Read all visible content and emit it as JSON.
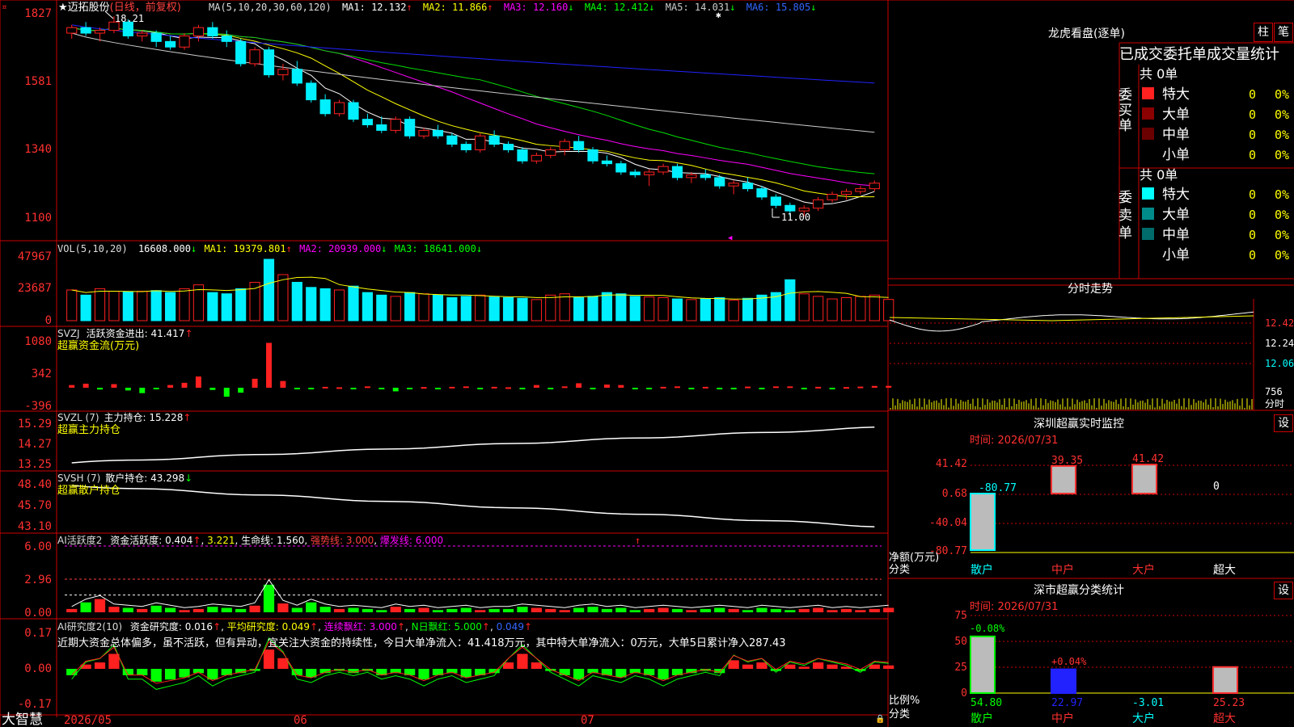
{
  "colors": {
    "up": "#ff2020",
    "down": "#00f0ff",
    "ma1": "#ffffff",
    "ma2": "#ffff00",
    "ma3": "#ff00ff",
    "ma4": "#00dd00",
    "ma5": "#cccccc",
    "ma6": "#2222ff",
    "frame": "#cc0000",
    "label_red": "#ff4040",
    "label_yellow": "#ffff00",
    "label_green": "#00ff00",
    "label_magenta": "#ff00ff",
    "label_cyan": "#00ffff",
    "label_blue": "#3366ff"
  },
  "header": {
    "title_prefix": "★",
    "stock_name": "迈拓股份",
    "period": "(日线，前复权)",
    "ma_params": "MA(5,10,20,30,60,120)",
    "ma1_text": "MA1: 12.132",
    "ma1_arrow": "↑",
    "ma2_text": "MA2: 11.866",
    "ma2_arrow": "↑",
    "ma3_text": "MA3: 12.160",
    "ma3_arrow": "↓",
    "ma4_text": "MA4: 12.412",
    "ma4_arrow": "↓",
    "ma5_text": "MA5: 14.031",
    "ma5_arrow": "↓",
    "ma6_text": "MA6: 15.805",
    "ma6_arrow": "↓",
    "high_label": "18.21",
    "low_label": "11.00"
  },
  "vol_pane": {
    "label": "VOL(5,10,20)",
    "vol_text": "16608.000",
    "vol_arrow": "↓",
    "ma1_text": "MA1: 19379.801",
    "ma1_arrow": "↑",
    "ma2_text": "MA2: 20939.000",
    "ma2_arrow": "↓",
    "ma3_text": "MA3: 18641.000",
    "ma3_arrow": "↓"
  },
  "svzj_pane": {
    "label": "SVZJ",
    "title": "活跃资金进出: 41.417",
    "arrow": "↑",
    "sub": "超赢资金流(万元)"
  },
  "svzl_pane": {
    "label": "SVZL (7)",
    "title": "主力持仓: 15.228",
    "arrow": "↑",
    "sub": "超赢主力持仓"
  },
  "svsh_pane": {
    "label": "SVSH (7)",
    "title": "散户持仓: 43.298",
    "arrow": "↓",
    "sub": "超赢散户持仓"
  },
  "ai1_pane": {
    "label": "AI活跃度2",
    "t1": "资金活跃度: 0.404",
    "a1": "↑",
    "t2": "3.221",
    "t3": "生命线: 1.560",
    "t4": "强势线: 3.000",
    "t5": "爆发线: 6.000"
  },
  "ai2_pane": {
    "label": "AI研究度2(10)",
    "t1": "资金研究度: 0.016",
    "a1": "↑",
    "t2": "平均研究度: 0.049",
    "a2": "↑",
    "t3": "连续飘红: 3.000",
    "a3": "↑",
    "t4": "N日飘红: 5.000",
    "a4": "↑",
    "t5": "0.049",
    "a5": "↑",
    "comment": "近期大资金总体偏多，虽不活跃，但有异动，宜关注大资金的持续性，今日大单净流入：41.418万元，其中特大单净流入：0万元，大单5日累计净入287.43"
  },
  "axis": {
    "price_ticks": [
      "1827",
      "1581",
      "1340",
      "1100"
    ],
    "vol_ticks": [
      "47967",
      "23687",
      "0"
    ],
    "svzj_ticks": [
      "1080",
      "342",
      "-396"
    ],
    "svzl_ticks": [
      "15.29",
      "14.27",
      "13.25"
    ],
    "svsh_ticks": [
      "48.40",
      "45.70",
      "43.10"
    ],
    "ai1_ticks": [
      "6.00",
      "2.96",
      "0.00"
    ],
    "ai2_ticks": [
      "0.17",
      "0.00",
      "-0.17"
    ],
    "date_labels": [
      "2026/05",
      "06",
      "07"
    ],
    "brand": "大智慧"
  },
  "right": {
    "lhb_title": "龙虎看盘(逐单)",
    "btn_zhu": "柱",
    "btn_bi": "笔",
    "lhb_header": "已成交委托单成交量统计",
    "buy_group": "委买单",
    "sell_group": "委卖单",
    "buy_total": "共 0单",
    "sell_total": "共 0单",
    "buy_rows": [
      {
        "name": "特大",
        "count": "0",
        "pct": "0%"
      },
      {
        "name": "大单",
        "count": "0",
        "pct": "0%"
      },
      {
        "name": "中单",
        "count": "0",
        "pct": "0%"
      },
      {
        "name": "小单",
        "count": "0",
        "pct": "0%"
      }
    ],
    "sell_rows": [
      {
        "name": "特大",
        "count": "0",
        "pct": "0%"
      },
      {
        "name": "大单",
        "count": "0",
        "pct": "0%"
      },
      {
        "name": "中单",
        "count": "0",
        "pct": "0%"
      },
      {
        "name": "小单",
        "count": "0",
        "pct": "0%"
      }
    ],
    "intraday_title": "分时走势",
    "intraday_ticks": [
      "12.42",
      "12.24",
      "12.06"
    ],
    "intraday_vol": "756",
    "intraday_unit": "分时",
    "monitor_title": "深圳超赢实时监控",
    "monitor_btn": "设",
    "monitor_time": "时间: 2026/07/31",
    "monitor_ticks": [
      "41.42",
      "0.68",
      "-40.04",
      "-80.77"
    ],
    "monitor_ylabel": "净额(万元)",
    "monitor_xlabel": "分类",
    "classify_title": "深市超赢分类统计",
    "classify_btn": "设",
    "classify_time": "时间: 2026/07/31",
    "classify_ticks": [
      "75",
      "50",
      "25",
      "0"
    ],
    "classify_ylabel": "比例%",
    "classify_xlabel": "分类",
    "classify_pcts": [
      "-0.08%",
      "+0.04%"
    ]
  },
  "chart_data": [
    {
      "type": "candlestick",
      "title": "迈拓股份 (日线，前复权)",
      "ylim": [
        11.0,
        18.27
      ],
      "y_ticks": [
        18.27,
        15.81,
        13.4,
        11.0
      ],
      "x_labels": [
        "2026/05",
        "06",
        "07"
      ],
      "high": 18.21,
      "low": 11.0,
      "ohlc": [
        [
          17.6,
          17.9,
          17.4,
          17.8
        ],
        [
          17.8,
          18.0,
          17.5,
          17.6
        ],
        [
          17.6,
          17.8,
          17.3,
          17.7
        ],
        [
          17.7,
          18.21,
          17.6,
          18.0
        ],
        [
          18.0,
          18.1,
          17.4,
          17.5
        ],
        [
          17.5,
          17.7,
          17.3,
          17.6
        ],
        [
          17.6,
          17.7,
          17.1,
          17.3
        ],
        [
          17.3,
          17.5,
          17.0,
          17.1
        ],
        [
          17.1,
          17.6,
          17.0,
          17.5
        ],
        [
          17.5,
          17.9,
          17.3,
          17.8
        ],
        [
          17.8,
          18.0,
          17.4,
          17.5
        ],
        [
          17.5,
          17.7,
          17.1,
          17.3
        ],
        [
          17.3,
          17.4,
          16.4,
          16.5
        ],
        [
          16.5,
          17.1,
          16.4,
          17.0
        ],
        [
          17.0,
          17.1,
          16.0,
          16.1
        ],
        [
          16.1,
          16.5,
          15.9,
          16.3
        ],
        [
          16.3,
          16.6,
          15.7,
          15.8
        ],
        [
          15.8,
          15.9,
          15.1,
          15.2
        ],
        [
          15.2,
          15.4,
          14.6,
          14.7
        ],
        [
          14.7,
          15.2,
          14.6,
          15.1
        ],
        [
          15.1,
          15.2,
          14.4,
          14.5
        ],
        [
          14.5,
          14.7,
          14.2,
          14.3
        ],
        [
          14.3,
          14.6,
          14.0,
          14.1
        ],
        [
          14.1,
          14.6,
          14.0,
          14.5
        ],
        [
          14.5,
          14.6,
          13.8,
          13.9
        ],
        [
          13.9,
          14.2,
          13.8,
          14.1
        ],
        [
          14.1,
          14.3,
          13.8,
          13.9
        ],
        [
          13.9,
          14.0,
          13.5,
          13.6
        ],
        [
          13.6,
          13.7,
          13.3,
          13.4
        ],
        [
          13.4,
          14.0,
          13.3,
          13.9
        ],
        [
          13.9,
          14.1,
          13.5,
          13.6
        ],
        [
          13.6,
          13.7,
          13.3,
          13.4
        ],
        [
          13.4,
          13.5,
          12.9,
          13.0
        ],
        [
          13.0,
          13.3,
          12.9,
          13.2
        ],
        [
          13.2,
          13.5,
          13.1,
          13.4
        ],
        [
          13.4,
          13.8,
          13.2,
          13.7
        ],
        [
          13.7,
          13.9,
          13.3,
          13.4
        ],
        [
          13.4,
          13.5,
          12.9,
          13.0
        ],
        [
          13.0,
          13.2,
          12.8,
          12.9
        ],
        [
          12.9,
          13.0,
          12.5,
          12.6
        ],
        [
          12.6,
          12.7,
          12.4,
          12.5
        ],
        [
          12.5,
          12.7,
          12.1,
          12.6
        ],
        [
          12.6,
          12.9,
          12.5,
          12.8
        ],
        [
          12.8,
          12.9,
          12.3,
          12.4
        ],
        [
          12.4,
          12.6,
          12.2,
          12.5
        ],
        [
          12.5,
          12.7,
          12.3,
          12.4
        ],
        [
          12.4,
          12.5,
          12.0,
          12.1
        ],
        [
          12.1,
          12.3,
          11.8,
          12.2
        ],
        [
          12.2,
          12.4,
          11.9,
          12.0
        ],
        [
          12.0,
          12.1,
          11.6,
          11.7
        ],
        [
          11.7,
          11.8,
          11.3,
          11.4
        ],
        [
          11.4,
          11.5,
          11.0,
          11.2
        ],
        [
          11.2,
          11.4,
          11.0,
          11.3
        ],
        [
          11.3,
          11.7,
          11.2,
          11.6
        ],
        [
          11.6,
          11.9,
          11.5,
          11.8
        ],
        [
          11.8,
          12.0,
          11.6,
          11.9
        ],
        [
          11.9,
          12.1,
          11.8,
          12.0
        ],
        [
          12.0,
          12.3,
          11.9,
          12.2
        ]
      ],
      "series": [
        {
          "name": "MA1",
          "value": 12.132
        },
        {
          "name": "MA2",
          "value": 11.866
        },
        {
          "name": "MA3",
          "value": 12.16
        },
        {
          "name": "MA4",
          "value": 12.412
        },
        {
          "name": "MA5",
          "value": 14.031
        },
        {
          "name": "MA6",
          "value": 15.805
        }
      ]
    },
    {
      "type": "bar",
      "title": "VOL(5,10,20)",
      "ylim": [
        0,
        47967
      ],
      "y_ticks": [
        47967,
        23687,
        0
      ],
      "values": [
        24000,
        20000,
        25000,
        23000,
        22500,
        23000,
        23500,
        22000,
        25000,
        28000,
        22000,
        21000,
        25000,
        30000,
        47967,
        36000,
        30000,
        26000,
        25000,
        24000,
        27000,
        22000,
        20000,
        19000,
        22000,
        21000,
        20000,
        18000,
        19000,
        20000,
        18500,
        18000,
        17500,
        16500,
        20000,
        21000,
        18000,
        19000,
        22000,
        21000,
        19000,
        18500,
        18000,
        17000,
        16500,
        17000,
        18000,
        16000,
        17500,
        20000,
        22000,
        32000,
        21000,
        19000,
        17000,
        18000,
        19000,
        20000,
        16608
      ],
      "series": [
        {
          "name": "MA1",
          "value": 19379.801
        },
        {
          "name": "MA2",
          "value": 20939.0
        },
        {
          "name": "MA3",
          "value": 18641.0
        }
      ]
    },
    {
      "type": "bar",
      "title": "超赢资金流(万元)",
      "ylim": [
        -396,
        1080
      ],
      "y_ticks": [
        1080,
        342,
        -396
      ],
      "values": [
        60,
        90,
        -40,
        80,
        -60,
        -120,
        -30,
        60,
        110,
        250,
        -50,
        -200,
        -110,
        200,
        1000,
        150,
        -20,
        -15,
        20,
        10,
        -30,
        30,
        -10,
        -80,
        -20,
        15,
        -20,
        20,
        30,
        -15,
        20,
        10,
        -20,
        60,
        -25,
        30,
        100,
        -20,
        70,
        60,
        -20,
        -20,
        20,
        30,
        -10,
        20,
        -15,
        -20,
        25,
        -20,
        30,
        30,
        -30,
        20,
        -25,
        15,
        25,
        40,
        41.417
      ],
      "latest": 41.417
    },
    {
      "type": "line",
      "title": "超赢主力持仓",
      "ylim": [
        13.25,
        15.29
      ],
      "y_ticks": [
        15.29,
        14.27,
        13.25
      ],
      "latest": 15.228
    },
    {
      "type": "line",
      "title": "超赢散户持仓",
      "ylim": [
        43.1,
        48.4
      ],
      "y_ticks": [
        48.4,
        45.7,
        43.1
      ],
      "latest": 43.298
    },
    {
      "type": "bar",
      "title": "AI活跃度2",
      "ylim": [
        0,
        6.0
      ],
      "y_ticks": [
        6.0,
        2.96,
        0.0
      ],
      "values": [
        0.3,
        0.9,
        1.2,
        0.5,
        0.4,
        0.3,
        0.6,
        0.4,
        0.2,
        0.3,
        0.5,
        0.4,
        0.3,
        0.6,
        2.5,
        0.8,
        0.4,
        0.9,
        0.5,
        0.3,
        0.4,
        0.3,
        0.2,
        0.5,
        0.3,
        0.4,
        0.2,
        0.3,
        0.4,
        0.2,
        0.3,
        0.3,
        0.5,
        0.4,
        0.3,
        0.2,
        0.4,
        0.5,
        0.3,
        0.4,
        0.2,
        0.3,
        0.4,
        0.3,
        0.2,
        0.3,
        0.4,
        0.3,
        0.2,
        0.4,
        0.3,
        0.2,
        0.3,
        0.4,
        0.2,
        0.3,
        0.2,
        0.3,
        0.404
      ],
      "series": [
        {
          "name": "资金活跃度",
          "value": 0.404
        },
        {
          "name": "生命线",
          "value": 1.56
        },
        {
          "name": "强势线",
          "value": 3.0
        },
        {
          "name": "爆发线",
          "value": 6.0
        }
      ]
    },
    {
      "type": "bar",
      "title": "AI研究度2(10)",
      "ylim": [
        -0.17,
        0.17
      ],
      "y_ticks": [
        0.17,
        0.0,
        -0.17
      ],
      "values": [
        -0.03,
        0.02,
        0.03,
        0.07,
        -0.03,
        -0.03,
        -0.06,
        -0.05,
        -0.04,
        -0.02,
        -0.05,
        -0.03,
        -0.02,
        -0.01,
        0.09,
        0.05,
        -0.03,
        -0.04,
        -0.02,
        -0.01,
        -0.02,
        -0.01,
        -0.03,
        -0.02,
        -0.03,
        -0.05,
        -0.03,
        -0.02,
        -0.04,
        -0.03,
        -0.02,
        0.03,
        0.07,
        0.03,
        -0.01,
        -0.03,
        -0.05,
        -0.02,
        -0.03,
        -0.04,
        -0.02,
        -0.03,
        -0.05,
        -0.03,
        -0.02,
        -0.01,
        -0.02,
        0.04,
        0.02,
        0.03,
        -0.01,
        0.02,
        0.01,
        0.03,
        0.02,
        0.01,
        -0.01,
        0.02,
        0.016
      ],
      "series": [
        {
          "name": "资金研究度",
          "value": 0.016
        },
        {
          "name": "平均研究度",
          "value": 0.049
        },
        {
          "name": "连续飘红",
          "value": 3.0
        },
        {
          "name": "N日飘红",
          "value": 5.0
        }
      ]
    },
    {
      "type": "bar",
      "title": "深圳超赢实时监控",
      "categories": [
        "散户",
        "中户",
        "大户",
        "超大"
      ],
      "values": [
        -80.77,
        39.35,
        41.42,
        0
      ],
      "ylim": [
        -80.77,
        41.42
      ],
      "y_ticks": [
        41.42,
        0.68,
        -40.04,
        -80.77
      ]
    },
    {
      "type": "bar",
      "title": "深市超赢分类统计",
      "categories": [
        "散户",
        "中户",
        "大户",
        "超大"
      ],
      "values": [
        54.8,
        22.97,
        -3.01,
        25.23
      ],
      "ylim": [
        0,
        75
      ],
      "y_ticks": [
        75,
        50,
        25,
        0
      ]
    }
  ]
}
